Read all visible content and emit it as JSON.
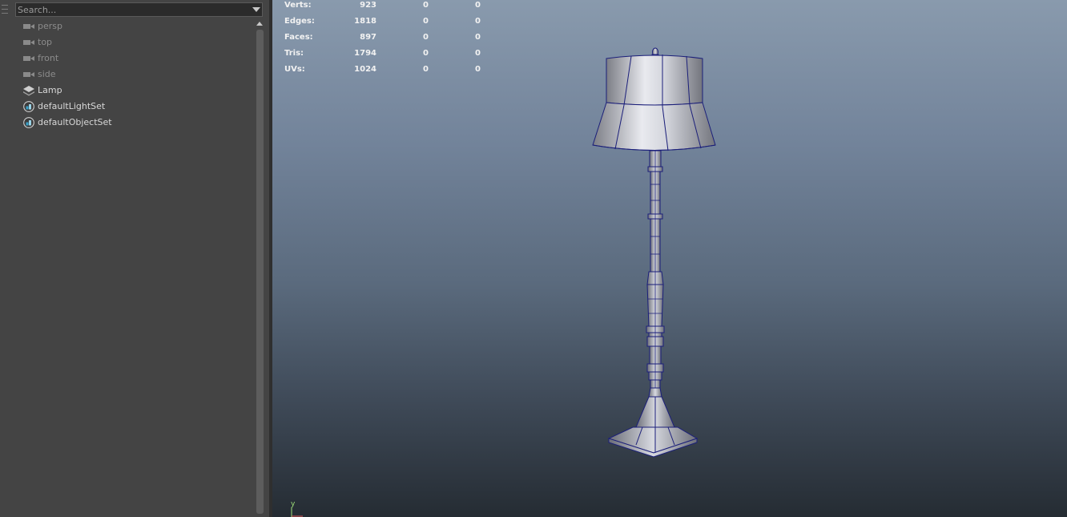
{
  "outliner": {
    "search_placeholder": "Search...",
    "items": [
      {
        "label": "persp",
        "icon": "camera-icon",
        "dim": true
      },
      {
        "label": "top",
        "icon": "camera-icon",
        "dim": true
      },
      {
        "label": "front",
        "icon": "camera-icon",
        "dim": true
      },
      {
        "label": "side",
        "icon": "camera-icon",
        "dim": true
      },
      {
        "label": "Lamp",
        "icon": "group-icon",
        "dim": false
      },
      {
        "label": "defaultLightSet",
        "icon": "set-icon",
        "dim": false
      },
      {
        "label": "defaultObjectSet",
        "icon": "set-icon",
        "dim": false
      }
    ]
  },
  "viewport": {
    "hud_stats": [
      {
        "label": "Verts:",
        "values": [
          "923",
          "0",
          "0"
        ]
      },
      {
        "label": "Edges:",
        "values": [
          "1818",
          "0",
          "0"
        ]
      },
      {
        "label": "Faces:",
        "values": [
          "897",
          "0",
          "0"
        ]
      },
      {
        "label": "Tris:",
        "values": [
          "1794",
          "0",
          "0"
        ]
      },
      {
        "label": "UVs:",
        "values": [
          "1024",
          "0",
          "0"
        ]
      }
    ],
    "axis_label": "y",
    "colors": {
      "wireframe": "#1b1f7a",
      "axis_y": "#9fe07a",
      "axis_x": "#e05a5a"
    }
  }
}
